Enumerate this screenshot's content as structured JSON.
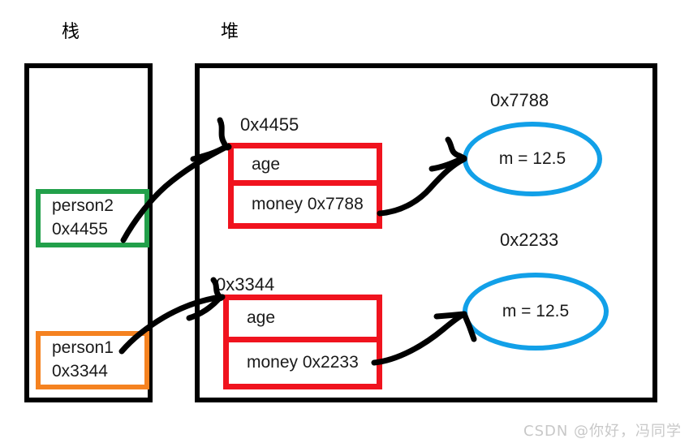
{
  "titles": {
    "stack": "栈",
    "heap": "堆"
  },
  "stack": {
    "variables": [
      {
        "name": "person2",
        "value": "0x4455",
        "color": "#22a04a"
      },
      {
        "name": "person1",
        "value": "0x3344",
        "color": "#f58220"
      }
    ]
  },
  "heap": {
    "structs": [
      {
        "address": "0x4455",
        "field_age": "age",
        "field_money": "money  0x7788",
        "color": "#f0131e"
      },
      {
        "address": "0x3344",
        "field_age": "age",
        "field_money": "money 0x2233",
        "color": "#f0131e"
      }
    ],
    "objects": [
      {
        "address": "0x7788",
        "text": "m = 12.5",
        "color": "#12a0e8"
      },
      {
        "address": "0x2233",
        "text": "m = 12.5",
        "color": "#12a0e8"
      }
    ]
  },
  "arrows": [
    {
      "name": "person2-to-struct-0x4455",
      "from": "person2",
      "to": "0x4455"
    },
    {
      "name": "person1-to-struct-0x3344",
      "from": "person1",
      "to": "0x3344"
    },
    {
      "name": "money-0x7788-to-object",
      "from": "money 0x7788",
      "to": "0x7788"
    },
    {
      "name": "money-0x2233-to-object",
      "from": "money 0x2233",
      "to": "0x2233"
    }
  ],
  "watermark": "CSDN @你好，冯同学"
}
